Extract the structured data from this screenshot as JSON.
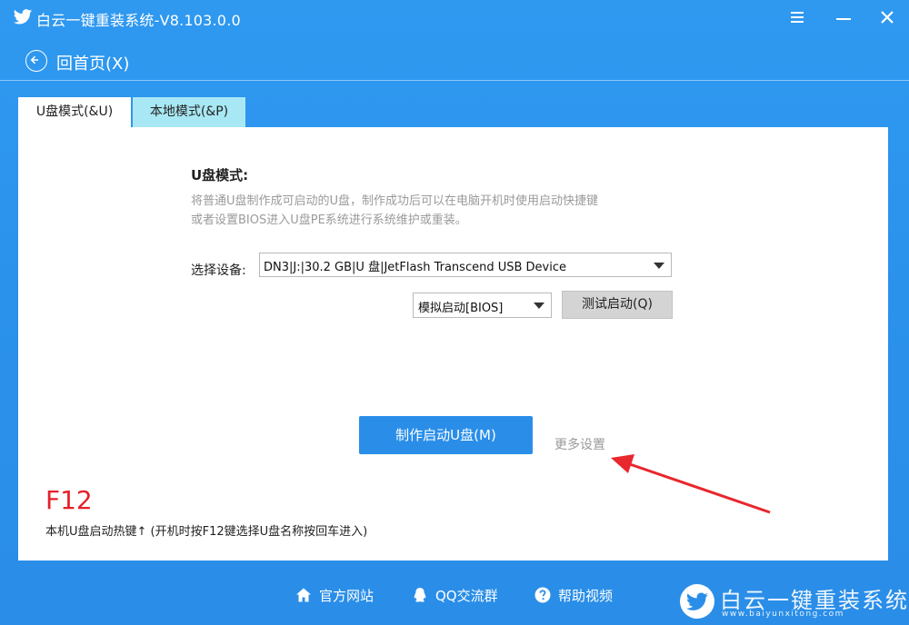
{
  "window": {
    "title": "白云一键重装系统-V8.103.0.0",
    "back_label": "回首页(X)"
  },
  "tabs": [
    {
      "label": "U盘模式(&U)",
      "active": true
    },
    {
      "label": "本地模式(&P)",
      "active": false
    }
  ],
  "usb_mode": {
    "title": "U盘模式:",
    "description_line1": "将普通U盘制作成可启动的U盘，制作成功后可以在电脑开机时使用启动快捷键",
    "description_line2": "或者设置BIOS进入U盘PE系统进行系统维护或重装。",
    "device_label": "选择设备:",
    "device_value": "DN3|J:|30.2 GB|U 盘|JetFlash Transcend USB Device",
    "boot_mode_value": "模拟启动[BIOS]",
    "test_button": "测试启动(Q)",
    "make_button": "制作启动U盘(M)",
    "more_settings": "更多设置"
  },
  "hotkey": {
    "key": "F12",
    "note": "本机U盘启动热键↑ (开机时按F12键选择U盘名称按回车进入)"
  },
  "footer": {
    "site": "官方网站",
    "qq": "QQ交流群",
    "help": "帮助视频"
  },
  "watermark": {
    "main": "白云一键重装系统",
    "sub": "www.baiyunxitong.com"
  },
  "colors": {
    "background": "#2a8ee8",
    "tab_inactive": "#a8e8f4",
    "primary_button": "#2a8ee9",
    "hotkey": "#e6202a",
    "annotation_arrow": "#e8272e"
  },
  "icons": {
    "app": "bird-icon",
    "menu": "menu-icon",
    "minimize": "minimize-icon",
    "close": "close-icon",
    "back": "back-arrow-icon",
    "site": "home-icon",
    "qq": "qq-penguin-icon",
    "help": "help-icon"
  }
}
